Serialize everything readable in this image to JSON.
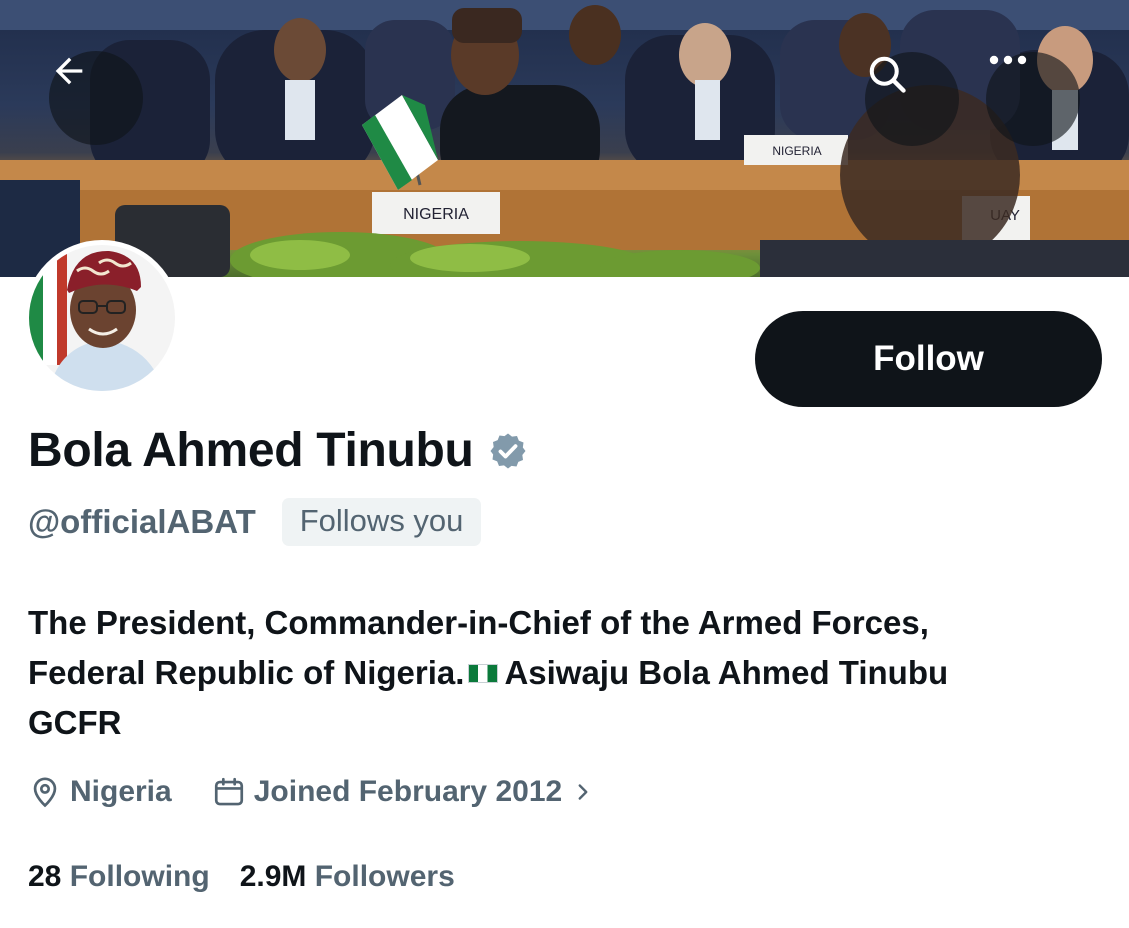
{
  "profile": {
    "display_name": "Bola Ahmed Tinubu",
    "handle": "@officialABAT",
    "follows_you": "Follows you",
    "bio_line1": "The President, Commander-in-Chief of the Armed Forces,",
    "bio_line2a": "Federal Republic of Nigeria.",
    "bio_line2b": "Asiwaju Bola Ahmed Tinubu",
    "bio_line3": "GCFR",
    "location": "Nigeria",
    "joined": "Joined February 2012",
    "following_count": "28",
    "following_label": "Following",
    "followers_count": "2.9M",
    "followers_label": "Followers"
  },
  "actions": {
    "follow_label": "Follow"
  },
  "banner": {
    "placard_1": "NIGERIA",
    "placard_2": "NIGERIA",
    "placard_3": "UAY"
  },
  "icons": {
    "back": "arrow-left-icon",
    "search": "search-icon",
    "more": "more-horizontal-icon",
    "verified": "verified-badge-icon",
    "location": "location-pin-icon",
    "calendar": "calendar-icon",
    "chevron": "chevron-right-icon",
    "flag": "nigeria-flag-icon"
  },
  "colors": {
    "primary_text": "#0f1419",
    "secondary_text": "#536471",
    "follow_bg": "#0f1419",
    "badge_bg": "#eff3f4",
    "verified_grey": "#829aab",
    "flag_green": "#0b7a3b"
  }
}
